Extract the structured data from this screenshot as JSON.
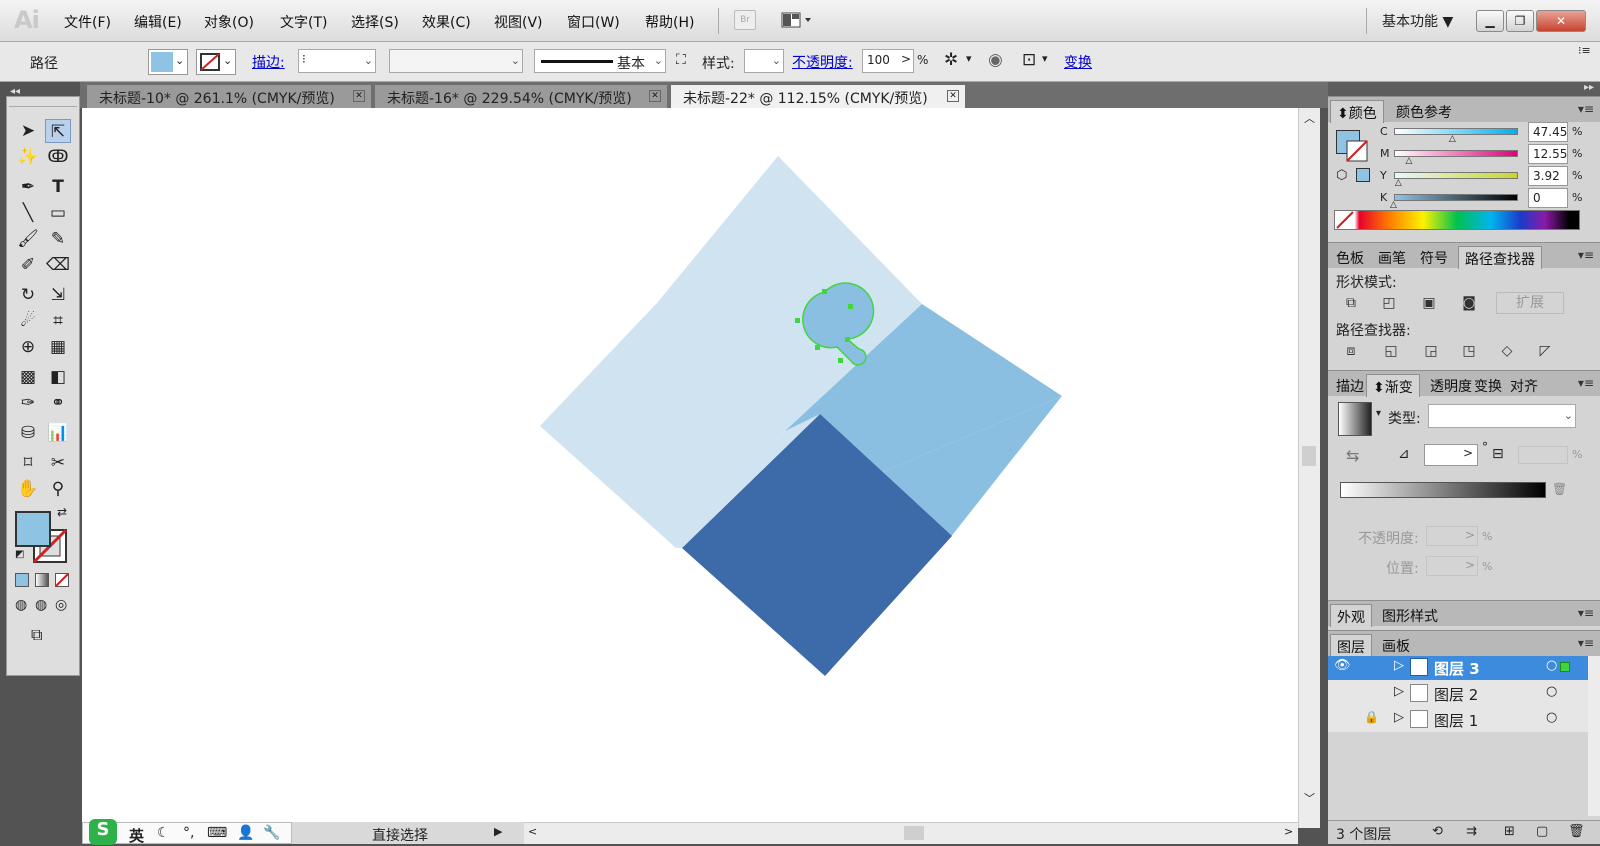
{
  "app": {
    "logo": "Ai",
    "workspace": "基本功能 ▼",
    "br": "Br"
  },
  "menu": [
    "文件(F)",
    "编辑(E)",
    "对象(O)",
    "文字(T)",
    "选择(S)",
    "效果(C)",
    "视图(V)",
    "窗口(W)",
    "帮助(H)"
  ],
  "control": {
    "path_label": "路径",
    "stroke_label": "描边:",
    "stroke_up": "⁝",
    "stroke_style": "基本",
    "style_label": "样式:",
    "opacity_label": "不透明度:",
    "opacity_value": "100",
    "opacity_unit": "%",
    "transform_label": "变换"
  },
  "tabs": [
    {
      "title": "未标题-10* @ 261.1% (CMYK/预览)"
    },
    {
      "title": "未标题-16* @ 229.54% (CMYK/预览)"
    },
    {
      "title": "未标题-22* @ 112.15% (CMYK/预览)"
    }
  ],
  "colors": {
    "fill": "#8fc3e4",
    "light_shape": "#d0e3f1",
    "mid_shape": "#8bbfe1",
    "dark_shape": "#3d6aa8",
    "selection": "#3fd63f"
  },
  "color_panel": {
    "tabs": [
      "颜色",
      "颜色参考"
    ],
    "channels": [
      {
        "name": "C",
        "value": "47.45",
        "unit": "%",
        "level": 0.4745
      },
      {
        "name": "M",
        "value": "12.55",
        "unit": "%",
        "level": 0.1255
      },
      {
        "name": "Y",
        "value": "3.92",
        "unit": "%",
        "level": 0.0392
      },
      {
        "name": "K",
        "value": "0",
        "unit": "%",
        "level": 0
      }
    ]
  },
  "pathfinder": {
    "tabs": [
      "色板",
      "画笔",
      "符号",
      "路径查找器"
    ],
    "shape_modes_label": "形状模式:",
    "expand_label": "扩展",
    "pathfinder_label": "路径查找器:"
  },
  "gradient": {
    "tabs": [
      "描边",
      "渐变",
      "透明度",
      "变换",
      "对齐"
    ],
    "type_label": "类型:",
    "opacity_label": "不透明度:",
    "position_label": "位置:",
    "deg": "°",
    "pct": "%"
  },
  "appearance": {
    "tabs": [
      "外观",
      "图形样式"
    ]
  },
  "layers": {
    "tabs": [
      "图层",
      "画板"
    ],
    "rows": [
      {
        "name": "图层 3",
        "selected": true
      },
      {
        "name": "图层 2",
        "selected": false
      },
      {
        "name": "图层 1",
        "selected": false
      }
    ],
    "count_label": "3 个图层"
  },
  "status": {
    "tool_name": "直接选择",
    "ime_label": "英"
  }
}
